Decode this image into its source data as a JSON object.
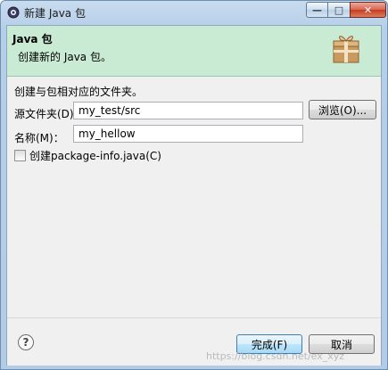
{
  "window": {
    "title": "新建 Java 包",
    "minimize_label": "—",
    "maximize_label": "□",
    "close_label": "✕"
  },
  "banner": {
    "title": "Java 包",
    "description": "创建新的 Java 包。"
  },
  "form": {
    "prompt": "创建与包相对应的文件夹。",
    "source_folder_label": "源文件夹(D)：",
    "source_folder_value": "my_test/src",
    "browse_label": "浏览(O)...",
    "name_label": "名称(M)：",
    "name_value": "my_hellow",
    "create_package_info_label": "创建package-info.java(C)",
    "create_package_info_checked": false
  },
  "footer": {
    "help_label": "?",
    "finish_label": "完成(F)",
    "cancel_label": "取消"
  },
  "watermark": "https://blog.csdn.net/ex_xyz"
}
